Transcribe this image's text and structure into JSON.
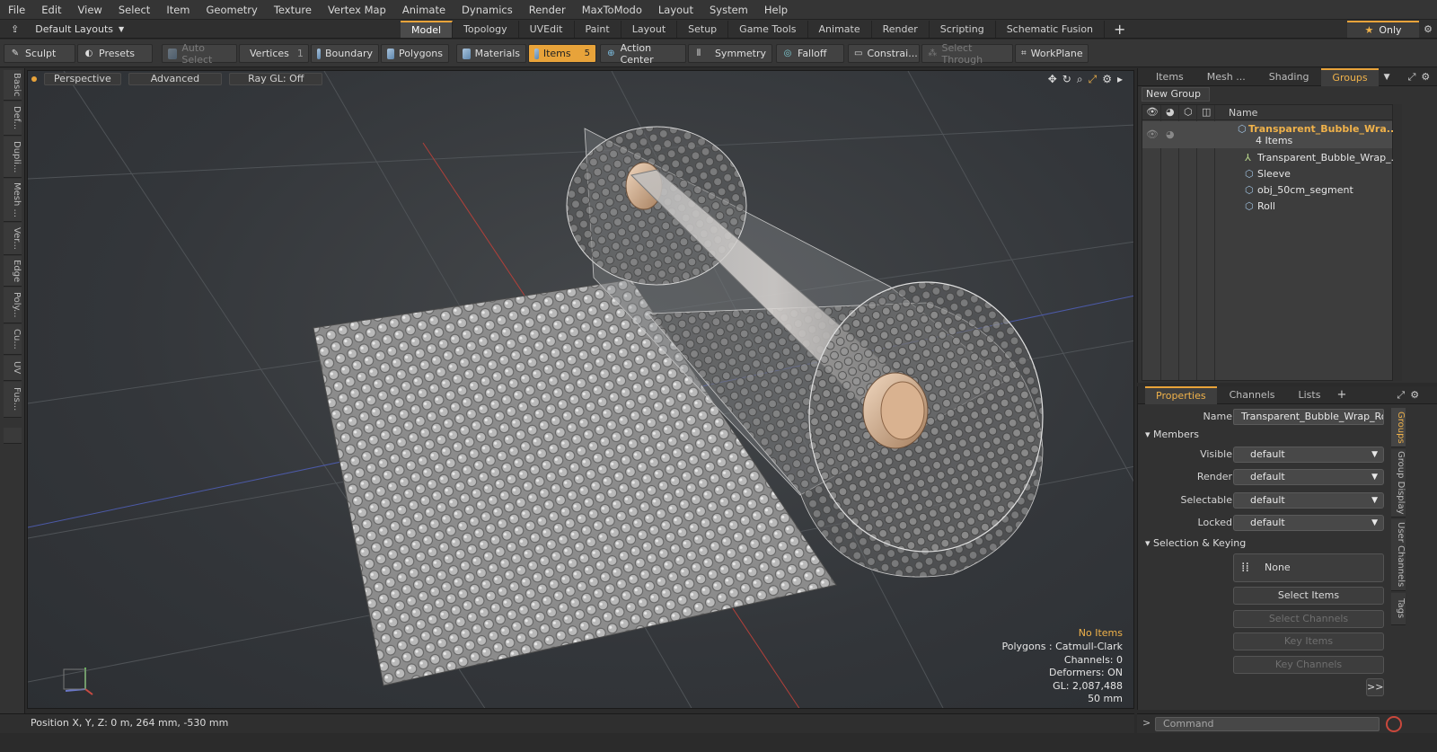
{
  "menu": [
    "File",
    "Edit",
    "View",
    "Select",
    "Item",
    "Geometry",
    "Texture",
    "Vertex Map",
    "Animate",
    "Dynamics",
    "Render",
    "MaxToModo",
    "Layout",
    "System",
    "Help"
  ],
  "layouts": {
    "label": "Default Layouts"
  },
  "top_tabs": [
    {
      "label": "Model",
      "active": true
    },
    {
      "label": "Topology"
    },
    {
      "label": "UVEdit"
    },
    {
      "label": "Paint"
    },
    {
      "label": "Layout"
    },
    {
      "label": "Setup"
    },
    {
      "label": "Game Tools"
    },
    {
      "label": "Animate"
    },
    {
      "label": "Render"
    },
    {
      "label": "Scripting"
    },
    {
      "label": "Schematic Fusion"
    }
  ],
  "only_label": "Only",
  "toolbar": {
    "sculpt": "Sculpt",
    "presets": "Presets",
    "auto_select": "Auto Select",
    "vertices": "Vertices",
    "vertices_count": "1",
    "boundary": "Boundary",
    "polygons": "Polygons",
    "materials": "Materials",
    "items": "Items",
    "items_count": "5",
    "action_center": "Action Center",
    "symmetry": "Symmetry",
    "falloff": "Falloff",
    "constraints": "Constrai...",
    "select_through": "Select Through",
    "workplane": "WorkPlane"
  },
  "left_tabs": [
    "Basic",
    "Def...",
    "Dupli...",
    "Mesh ...",
    "Ver...",
    "Edge",
    "Poly...",
    "Cu...",
    "UV",
    "Fus..."
  ],
  "viewport": {
    "mode": "Perspective",
    "advanced": "Advanced",
    "raygl": "Ray GL: Off",
    "info": {
      "no_items": "No Items",
      "polygons": "Polygons : Catmull-Clark",
      "channels": "Channels: 0",
      "deformers": "Deformers: ON",
      "gl": "GL: 2,087,488",
      "scale": "50 mm"
    }
  },
  "status": "Position X, Y, Z:   0 m, 264 mm, -530 mm",
  "right_tabs": [
    {
      "label": "Items"
    },
    {
      "label": "Mesh ..."
    },
    {
      "label": "Shading"
    },
    {
      "label": "Groups",
      "active": true
    }
  ],
  "new_group": "New Group",
  "tree": {
    "name_header": "Name",
    "group_name": "Transparent_Bubble_Wra...",
    "group_count": "4 Items",
    "children": [
      "Transparent_Bubble_Wrap_...",
      "Sleeve",
      "obj_50cm_segment",
      "Roll"
    ]
  },
  "prop_tabs": [
    {
      "label": "Properties",
      "active": true
    },
    {
      "label": "Channels"
    },
    {
      "label": "Lists"
    }
  ],
  "props": {
    "name_label": "Name",
    "name_value": "Transparent_Bubble_Wrap_Roll_f",
    "members": "Members",
    "visible_label": "Visible",
    "visible_value": "default",
    "render_label": "Render",
    "render_value": "default",
    "selectable_label": "Selectable",
    "selectable_value": "default",
    "locked_label": "Locked",
    "locked_value": "default",
    "sel_keying": "Selection & Keying",
    "none": "None",
    "select_items": "Select Items",
    "select_channels": "Select Channels",
    "key_items": "Key Items",
    "key_channels": "Key Channels",
    "more": ">>"
  },
  "side_tabs": [
    "Groups",
    "Group Display",
    "User Channels",
    "Tags"
  ],
  "command_placeholder": "Command"
}
